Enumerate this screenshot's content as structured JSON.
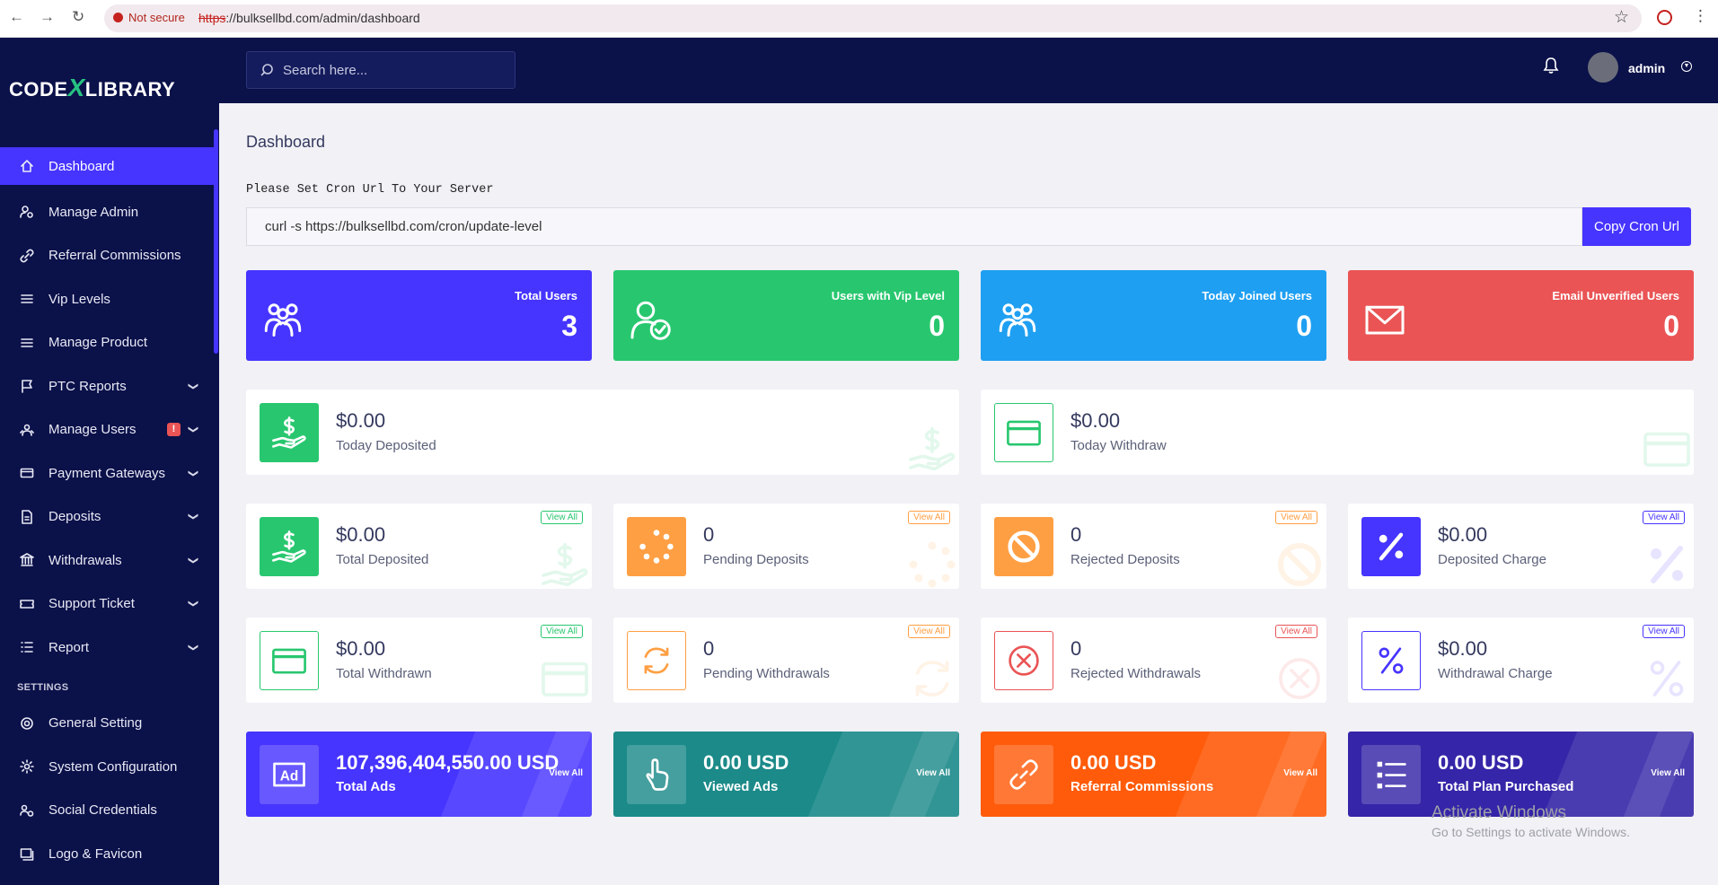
{
  "browser": {
    "security_label": "Not secure",
    "url_scheme": "https",
    "url_rest": "://bulksellbd.com/admin/dashboard"
  },
  "logo": {
    "part1": "CODE",
    "part2": "X",
    "part3": "LIBRARY"
  },
  "sidebar": {
    "items": [
      {
        "label": "Dashboard",
        "icon": "home-icon",
        "active": true
      },
      {
        "label": "Manage Admin",
        "icon": "user-cog-icon"
      },
      {
        "label": "Referral Commissions",
        "icon": "link-icon"
      },
      {
        "label": "Vip Levels",
        "icon": "bars-icon"
      },
      {
        "label": "Manage Product",
        "icon": "bars-icon"
      },
      {
        "label": "PTC Reports",
        "icon": "flag-icon",
        "chevron": true
      },
      {
        "label": "Manage Users",
        "icon": "users-icon",
        "chevron": true,
        "badge": "!"
      },
      {
        "label": "Payment Gateways",
        "icon": "credit-card-icon",
        "chevron": true
      },
      {
        "label": "Deposits",
        "icon": "file-money-icon",
        "chevron": true
      },
      {
        "label": "Withdrawals",
        "icon": "bank-icon",
        "chevron": true
      },
      {
        "label": "Support Ticket",
        "icon": "ticket-icon",
        "chevron": true
      },
      {
        "label": "Report",
        "icon": "list-icon",
        "chevron": true
      }
    ],
    "settings_title": "SETTINGS",
    "settings_items": [
      {
        "label": "General Setting",
        "icon": "life-ring-icon"
      },
      {
        "label": "System Configuration",
        "icon": "cog-icon"
      },
      {
        "label": "Social Credentials",
        "icon": "users-cog-icon"
      },
      {
        "label": "Logo & Favicon",
        "icon": "images-icon"
      }
    ]
  },
  "topbar": {
    "search_placeholder": "Search here...",
    "username": "admin"
  },
  "page": {
    "title": "Dashboard",
    "cron_label": "Please Set Cron Url To Your Server",
    "cron_value": "curl -s https://bulksellbd.com/cron/update-level",
    "cron_button": "Copy Cron Url"
  },
  "stats": [
    {
      "label": "Total Users",
      "value": "3",
      "color": "#4634ff",
      "icon": "users-icon"
    },
    {
      "label": "Users with Vip Level",
      "value": "0",
      "color": "#28c76f",
      "icon": "user-check-icon"
    },
    {
      "label": "Today Joined Users",
      "value": "0",
      "color": "#1e9ff2",
      "icon": "users-icon"
    },
    {
      "label": "Email Unverified Users",
      "value": "0",
      "color": "#ea5455",
      "icon": "envelope-icon"
    }
  ],
  "today": [
    {
      "amount": "$0.00",
      "caption": "Today Deposited",
      "icon": "hand-dollar-icon"
    },
    {
      "amount": "$0.00",
      "caption": "Today Withdraw",
      "icon": "credit-card-icon"
    }
  ],
  "deposits": [
    {
      "amount": "$0.00",
      "caption": "Total Deposited",
      "icon": "hand-dollar-icon",
      "color": "#28c76f"
    },
    {
      "amount": "0",
      "caption": "Pending Deposits",
      "icon": "spinner-icon",
      "color": "#ff9f43"
    },
    {
      "amount": "0",
      "caption": "Rejected Deposits",
      "icon": "ban-icon",
      "color": "#ff9f43"
    },
    {
      "amount": "$0.00",
      "caption": "Deposited Charge",
      "icon": "percent-icon",
      "color": "#4634ff"
    }
  ],
  "withdrawals": [
    {
      "amount": "$0.00",
      "caption": "Total Withdrawn",
      "icon": "credit-card-icon",
      "color": "#28c76f"
    },
    {
      "amount": "0",
      "caption": "Pending Withdrawals",
      "icon": "sync-icon",
      "color": "#ff9f43"
    },
    {
      "amount": "0",
      "caption": "Rejected Withdrawals",
      "icon": "times-circle-icon",
      "color": "#ea5455"
    },
    {
      "amount": "$0.00",
      "caption": "Withdrawal Charge",
      "icon": "percent-icon",
      "color": "#4634ff"
    }
  ],
  "bottom": [
    {
      "amount": "107,396,404,550.00 USD",
      "caption": "Total Ads",
      "icon": "ad-icon",
      "color": "#4634ff"
    },
    {
      "amount": "0.00 USD",
      "caption": "Viewed Ads",
      "icon": "pointer-icon",
      "color": "#1b8a89"
    },
    {
      "amount": "0.00 USD",
      "caption": "Referral Commissions",
      "icon": "link-icon",
      "color": "#ff5b0a"
    },
    {
      "amount": "0.00 USD",
      "caption": "Total Plan Purchased",
      "icon": "list-icon",
      "color": "#3525a8"
    }
  ],
  "view_all": "View All",
  "watermark": {
    "line1": "Activate Windows",
    "line2": "Go to Settings to activate Windows."
  }
}
